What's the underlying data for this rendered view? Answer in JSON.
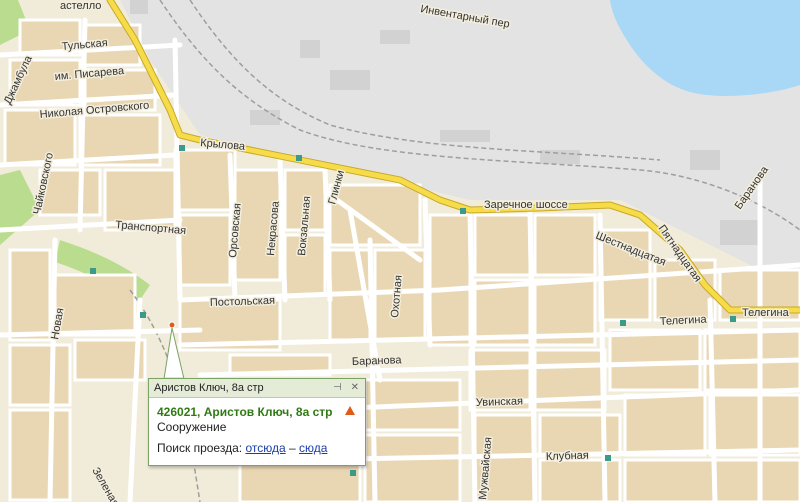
{
  "map": {
    "streets": {
      "rastello": "астелло",
      "tulskaya": "Тульская",
      "pisareva": "им. Писарева",
      "dzhambula": "Джамбула",
      "ostrovskogo": "Николая Островского",
      "chaikovskogo": "Чайковского",
      "transportnaya": "Транспортная",
      "krylova": "Крылова",
      "inventarny": "Инвентарный пер",
      "zarechnoe": "Заречное шоссе",
      "baranova_ne": "Баранова",
      "shestnadtsataya": "Шестнадцатая",
      "pyatnadtsataya": "Пятнадцатая",
      "telegina_a": "Телегина",
      "telegina_b": "Телегина",
      "orsovskaya": "Орсовская",
      "nekrasova": "Некрасова",
      "vokzalnaya": "Вокзальная",
      "glinki": "Глинки",
      "postolskaya": "Постольская",
      "okhotnaya": "Охотная",
      "novaya": "Новая",
      "baranova": "Баранова",
      "uvinskaya": "Увинская",
      "klubnaya": "Клубная",
      "muzhvayskaya": "Мужвайская",
      "zelenaya": "Зеленая"
    },
    "colors": {
      "background": "#f1ecd9",
      "block": "#e7d6b3",
      "industrial": "#e2e2e2",
      "water": "#a8d8f5",
      "park": "#b9dc8f",
      "main_road": "#f5d63a",
      "road": "#ffffff",
      "rail": "#9b9b9b",
      "marker": "#e05a1a"
    }
  },
  "popup": {
    "header": "Аристов Ключ, 8а стр",
    "pin_icon": "pin-icon",
    "close_icon": "close-icon",
    "title": "426021, Аристов Ключ, 8а стр",
    "type": "Сооружение",
    "route_label": "Поиск проезда:",
    "from_here": "отсюда",
    "dash": "–",
    "to_here": "сюда",
    "warning_icon": "warning-icon"
  }
}
